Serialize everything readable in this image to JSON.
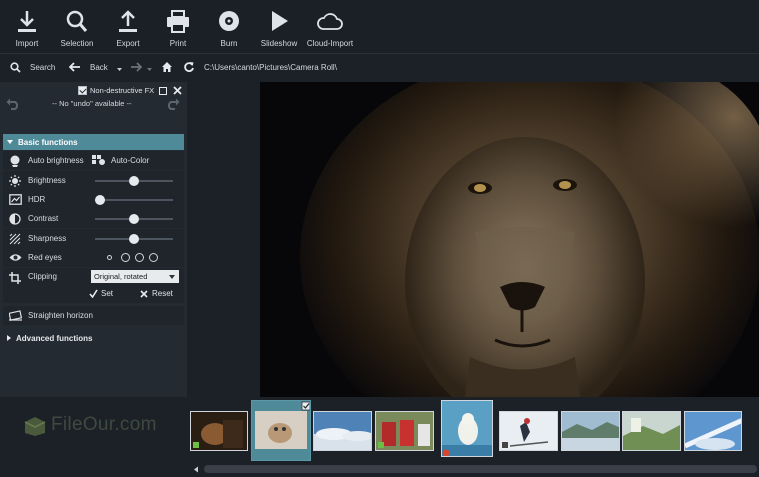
{
  "toolbar": {
    "import": "Import",
    "selection": "Selection",
    "export": "Export",
    "print": "Print",
    "burn": "Burn",
    "slideshow": "Slideshow",
    "cloud_import": "Cloud-Import"
  },
  "addressbar": {
    "search": "Search",
    "back": "Back",
    "path": "C:\\Users\\canto\\Pictures\\Camera Roll\\"
  },
  "fx_panel": {
    "nondestructive_label": "Non-destructive FX",
    "nondestructive_checked": true,
    "undo_status": "-- No \"undo\" available --"
  },
  "basic_functions": {
    "title": "Basic functions",
    "auto_brightness": "Auto brightness",
    "auto_color": "Auto-Color",
    "brightness": "Brightness",
    "hdr": "HDR",
    "contrast": "Contrast",
    "sharpness": "Sharpness",
    "red_eyes": "Red eyes",
    "clipping": "Clipping",
    "clipping_value": "Original, rotated",
    "set": "Set",
    "reset": "Reset",
    "straighten": "Straighten horizon",
    "slider_values": {
      "brightness": 0.5,
      "hdr": 0.0,
      "contrast": 0.5,
      "sharpness": 0.5
    }
  },
  "advanced_functions": {
    "title": "Advanced functions"
  },
  "watermark": {
    "text": "FileOur.com"
  },
  "icons": {
    "import": "download-icon",
    "selection": "magnifier-icon",
    "export": "upload-icon",
    "print": "printer-icon",
    "burn": "disc-icon",
    "slideshow": "play-icon",
    "cloud_import": "cloud-icon"
  },
  "colors": {
    "accent": "#4f8a99",
    "background": "#1c2127",
    "panel": "#242a31"
  }
}
